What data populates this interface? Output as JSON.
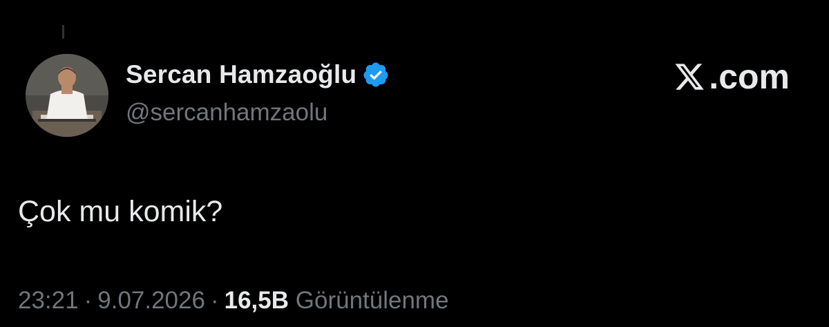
{
  "author": {
    "display_name": "Sercan Hamzaoğlu",
    "handle": "@sercanhamzaolu",
    "verified": true,
    "verified_color": "#1d9bf0",
    "avatar_icon": "profile-photo"
  },
  "brand": {
    "logo_icon": "x-logo",
    "domain": ".com"
  },
  "tweet": {
    "text": "Çok mu komik?"
  },
  "meta": {
    "time": "23:21",
    "separator": "·",
    "date": "9.07.2026",
    "views_count": "16,5B",
    "views_label": "Görüntülenme"
  },
  "colors": {
    "background": "#000000",
    "primary_text": "#e7e9ea",
    "secondary_text": "#71767b"
  }
}
